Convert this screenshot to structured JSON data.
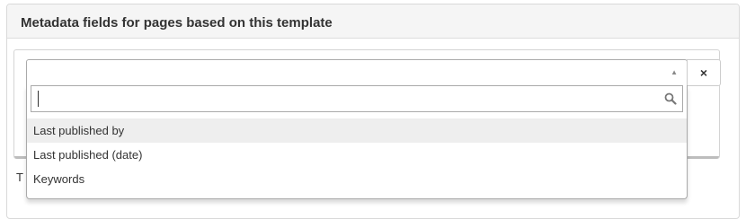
{
  "panel": {
    "title": "Metadata fields for pages based on this template"
  },
  "select": {
    "selected_value": "",
    "clear_label": "×"
  },
  "search": {
    "value": "",
    "placeholder": ""
  },
  "options": [
    {
      "label": "Last published by",
      "highlighted": true
    },
    {
      "label": "Last published (date)",
      "highlighted": false
    },
    {
      "label": "Keywords",
      "highlighted": false
    }
  ],
  "below_text": "T",
  "icons": {
    "arrow": "chevron-up-icon",
    "search": "search-icon",
    "clear": "close-icon"
  }
}
